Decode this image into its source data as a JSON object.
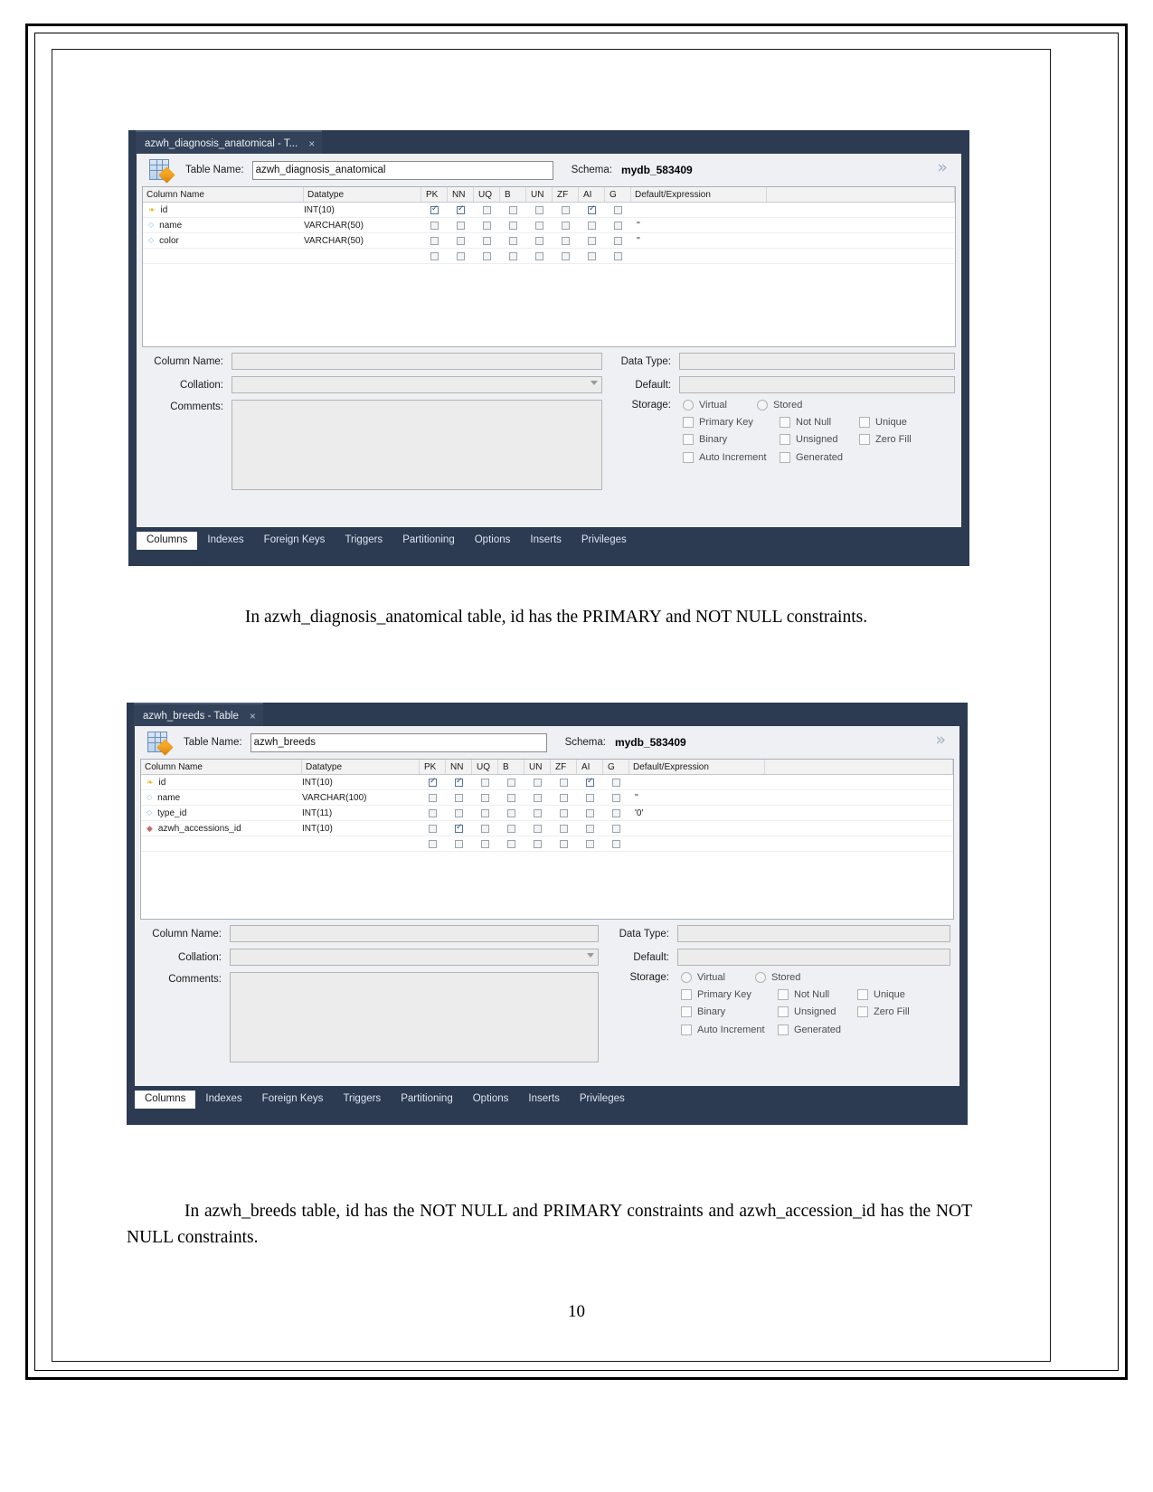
{
  "document": {
    "page_number": "10"
  },
  "panels": [
    {
      "id": "panel-diagnosis",
      "tab_title": "azwh_diagnosis_anatomical - T...",
      "tab_close": "×",
      "table_name_label": "Table Name:",
      "table_name_value": "azwh_diagnosis_anatomical",
      "schema_label": "Schema:",
      "schema_value": "mydb_583409",
      "collapse_icon": "»",
      "grid_headers": [
        "Column Name",
        "Datatype",
        "PK",
        "NN",
        "UQ",
        "B",
        "UN",
        "ZF",
        "AI",
        "G",
        "Default/Expression"
      ],
      "rows": [
        {
          "icon": "primary-key",
          "name": "id",
          "datatype": "INT(10)",
          "pk": true,
          "nn": true,
          "uq": false,
          "b": false,
          "un": false,
          "zf": false,
          "ai": true,
          "g": false,
          "default": ""
        },
        {
          "icon": "column",
          "name": "name",
          "datatype": "VARCHAR(50)",
          "pk": false,
          "nn": false,
          "uq": false,
          "b": false,
          "un": false,
          "zf": false,
          "ai": false,
          "g": false,
          "default": "''"
        },
        {
          "icon": "column",
          "name": "color",
          "datatype": "VARCHAR(50)",
          "pk": false,
          "nn": false,
          "uq": false,
          "b": false,
          "un": false,
          "zf": false,
          "ai": false,
          "g": false,
          "default": "''"
        },
        {
          "icon": "none",
          "name": "",
          "datatype": "",
          "pk": false,
          "nn": false,
          "uq": false,
          "b": false,
          "un": false,
          "zf": false,
          "ai": false,
          "g": false,
          "default": ""
        }
      ],
      "form": {
        "column_name_label": "Column Name:",
        "column_name_value": "",
        "collation_label": "Collation:",
        "collation_value": "",
        "comments_label": "Comments:",
        "comments_value": "",
        "data_type_label": "Data Type:",
        "data_type_value": "",
        "default_label": "Default:",
        "default_value": "",
        "storage_label": "Storage:",
        "virtual_label": "Virtual",
        "stored_label": "Stored",
        "primary_key_label": "Primary Key",
        "not_null_label": "Not Null",
        "unique_label": "Unique",
        "binary_label": "Binary",
        "unsigned_label": "Unsigned",
        "zero_fill_label": "Zero Fill",
        "auto_increment_label": "Auto Increment",
        "generated_label": "Generated"
      },
      "bottom_tabs": [
        "Columns",
        "Indexes",
        "Foreign Keys",
        "Triggers",
        "Partitioning",
        "Options",
        "Inserts",
        "Privileges"
      ],
      "active_bottom_tab": "Columns"
    },
    {
      "id": "panel-breeds",
      "tab_title": "azwh_breeds - Table",
      "tab_close": "×",
      "table_name_label": "Table Name:",
      "table_name_value": "azwh_breeds",
      "schema_label": "Schema:",
      "schema_value": "mydb_583409",
      "collapse_icon": "»",
      "grid_headers": [
        "Column Name",
        "Datatype",
        "PK",
        "NN",
        "UQ",
        "B",
        "UN",
        "ZF",
        "AI",
        "G",
        "Default/Expression"
      ],
      "rows": [
        {
          "icon": "primary-key",
          "name": "id",
          "datatype": "INT(10)",
          "pk": true,
          "nn": true,
          "uq": false,
          "b": false,
          "un": false,
          "zf": false,
          "ai": true,
          "g": false,
          "default": ""
        },
        {
          "icon": "column",
          "name": "name",
          "datatype": "VARCHAR(100)",
          "pk": false,
          "nn": false,
          "uq": false,
          "b": false,
          "un": false,
          "zf": false,
          "ai": false,
          "g": false,
          "default": "''"
        },
        {
          "icon": "column",
          "name": "type_id",
          "datatype": "INT(11)",
          "pk": false,
          "nn": false,
          "uq": false,
          "b": false,
          "un": false,
          "zf": false,
          "ai": false,
          "g": false,
          "default": "'0'"
        },
        {
          "icon": "foreign-key",
          "name": "azwh_accessions_id",
          "datatype": "INT(10)",
          "pk": false,
          "nn": true,
          "uq": false,
          "b": false,
          "un": false,
          "zf": false,
          "ai": false,
          "g": false,
          "default": ""
        },
        {
          "icon": "none",
          "name": "",
          "datatype": "",
          "pk": false,
          "nn": false,
          "uq": false,
          "b": false,
          "un": false,
          "zf": false,
          "ai": false,
          "g": false,
          "default": ""
        }
      ],
      "form": {
        "column_name_label": "Column Name:",
        "column_name_value": "",
        "collation_label": "Collation:",
        "collation_value": "",
        "comments_label": "Comments:",
        "comments_value": "",
        "data_type_label": "Data Type:",
        "data_type_value": "",
        "default_label": "Default:",
        "default_value": "",
        "storage_label": "Storage:",
        "virtual_label": "Virtual",
        "stored_label": "Stored",
        "primary_key_label": "Primary Key",
        "not_null_label": "Not Null",
        "unique_label": "Unique",
        "binary_label": "Binary",
        "unsigned_label": "Unsigned",
        "zero_fill_label": "Zero Fill",
        "auto_increment_label": "Auto Increment",
        "generated_label": "Generated"
      },
      "bottom_tabs": [
        "Columns",
        "Indexes",
        "Foreign Keys",
        "Triggers",
        "Partitioning",
        "Options",
        "Inserts",
        "Privileges"
      ],
      "active_bottom_tab": "Columns"
    }
  ],
  "captions": {
    "first": "In azwh_diagnosis_anatomical table, id has the PRIMARY and NOT NULL constraints.",
    "second": "In azwh_breeds table, id has the NOT NULL and PRIMARY constraints and azwh_accession_id has the NOT NULL constraints."
  }
}
